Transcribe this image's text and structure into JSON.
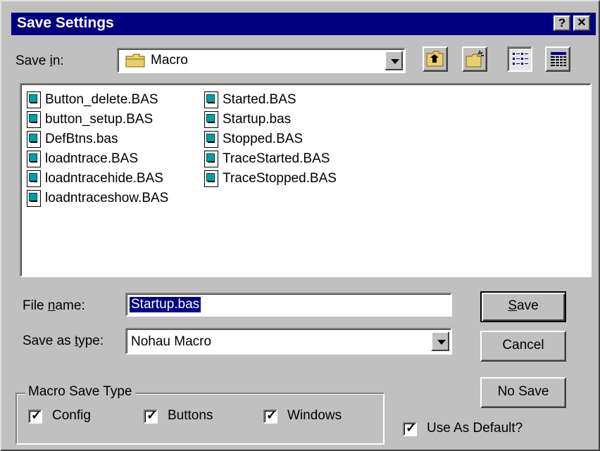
{
  "window": {
    "title": "Save Settings",
    "help_label": "?",
    "close_label": "✕"
  },
  "save_in": {
    "label_pre": "Save ",
    "label_key": "i",
    "label_post": "n:",
    "folder": "Macro"
  },
  "files": {
    "column1": [
      "Button_delete.BAS",
      "button_setup.BAS",
      "DefBtns.bas",
      "loadntrace.BAS",
      "loadntracehide.BAS",
      "loadntraceshow.BAS"
    ],
    "column2": [
      "Started.BAS",
      "Startup.bas",
      "Stopped.BAS",
      "TraceStarted.BAS",
      "TraceStopped.BAS"
    ]
  },
  "file_name": {
    "label_pre": "File ",
    "label_key": "n",
    "label_post": "ame:",
    "value": "Startup.bas"
  },
  "save_type": {
    "label_pre": "Save as ",
    "label_key": "t",
    "label_post": "ype:",
    "value": "Nohau Macro"
  },
  "buttons": {
    "save_key": "S",
    "save_rest": "ave",
    "cancel": "Cancel",
    "no_save": "No Save"
  },
  "macro_save_type": {
    "legend": "Macro Save Type",
    "config": "Config",
    "buttons": "Buttons",
    "windows": "Windows"
  },
  "use_default": "Use As Default?",
  "checkmark": "✓",
  "colors": {
    "title_bar": "#000080",
    "face": "#c0c0c0",
    "selection": "#000080"
  }
}
